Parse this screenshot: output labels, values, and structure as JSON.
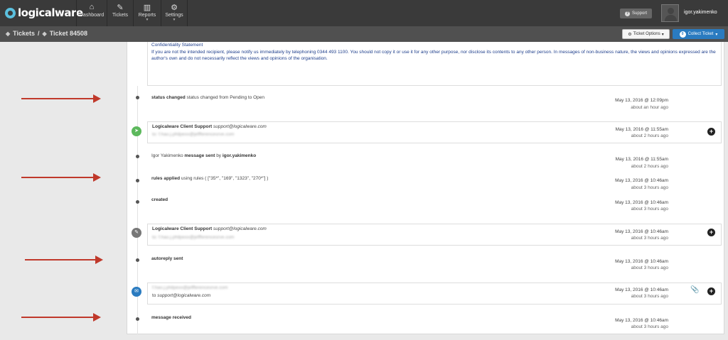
{
  "app": {
    "logo": "logicalware"
  },
  "nav": {
    "items": [
      {
        "label": "Dashboard",
        "icon": "home-icon"
      },
      {
        "label": "Tickets",
        "icon": "tags-icon"
      },
      {
        "label": "Reports",
        "icon": "bar-chart-icon"
      },
      {
        "label": "Settings",
        "icon": "gear-icon"
      }
    ],
    "support_label": "Support",
    "username": "igor.yakimenko"
  },
  "breadcrumb": {
    "section": "Tickets",
    "separator": "/",
    "ticket": "Ticket 84508"
  },
  "toolbar": {
    "ticket_options_label": "Ticket Options",
    "collect_ticket_label": "Collect Ticket",
    "collect_badge": "0"
  },
  "email_body": {
    "heading": "Confidentiality Statement",
    "text": "If you are not the intended recipient, please notify us immediately by telephoning 0344 493 1100. You should not copy it or use it for any other purpose, nor disclose its contents to any other person. In messages of non-business nature, the views and opinions expressed are the author's own and do not necessarily reflect the views and opinions of the organisation."
  },
  "timeline": [
    {
      "action": "status changed",
      "detail": "status changed from Pending to Open",
      "time": "May 13, 2016 @ 12:09pm",
      "ago": "about an hour ago"
    },
    {
      "from_name": "Logicalware Client Support",
      "from_email": "support@logicalware.com",
      "to_line": "to: f.hao.j.philpexx@jeffferencesrve.com",
      "time": "May 13, 2016 @ 11:55am",
      "ago": "about 2 hours ago"
    },
    {
      "actor": "Igor Yakimenko",
      "action": "message sent",
      "by_word": "by",
      "by_user": "igor.yakimenko",
      "time": "May 13, 2016 @ 11:55am",
      "ago": "about 2 hours ago"
    },
    {
      "action": "rules applied",
      "detail": "using rules ( [\"35*\", \"169\", \"1323\", \"270*\"] )",
      "time": "May 13, 2016 @ 10:46am",
      "ago": "about 3 hours ago"
    },
    {
      "action": "created",
      "time": "May 13, 2016 @ 10:46am",
      "ago": "about 3 hours ago"
    },
    {
      "from_name": "Logicalware Client Support",
      "from_email": "support@logicalware.com",
      "to_line": "to: f.hao.j.philpexx@jeffferencesrve.com",
      "time": "May 13, 2016 @ 10:46am",
      "ago": "about 3 hours ago"
    },
    {
      "action": "autoreply sent",
      "time": "May 13, 2016 @ 10:46am",
      "ago": "about 3 hours ago"
    },
    {
      "from_line": "f.hao.j.philpexx@jeffferencesrve.com",
      "to_prefix": "to",
      "to_email": "support@logicalware.com",
      "time": "May 13, 2016 @ 10:46am",
      "ago": "about 3 hours ago"
    },
    {
      "action": "message received",
      "time": "May 13, 2016 @ 10:46am",
      "ago": "about 3 hours ago"
    }
  ],
  "colors": {
    "topbar": "#3a3a3a",
    "subbar": "#505050",
    "primary": "#2a7bc0",
    "arrow": "#c0392b",
    "send_icon_bg": "#5cb85c",
    "edit_icon_bg": "#777777",
    "mail_icon_bg": "#2a7bc0"
  }
}
